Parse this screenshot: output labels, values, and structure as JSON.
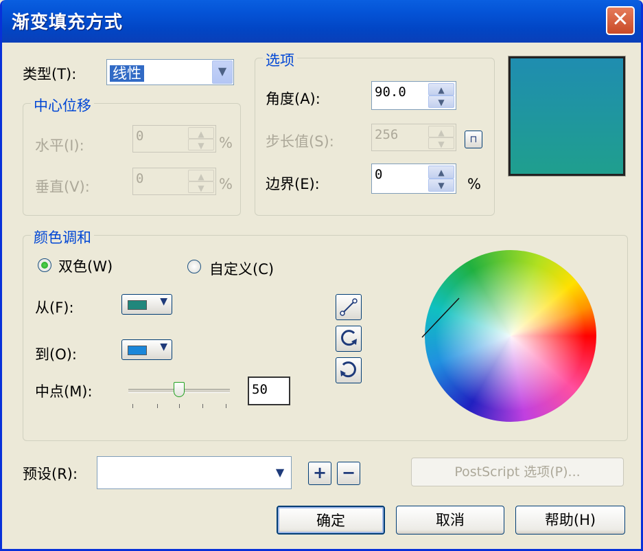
{
  "window": {
    "title": "渐变填充方式",
    "close": "✕"
  },
  "type": {
    "label": "类型(T):",
    "value": "线性"
  },
  "center_offset": {
    "legend": "中心位移",
    "horizontal_label": "水平(I):",
    "horizontal_value": "0",
    "horizontal_unit": "%",
    "vertical_label": "垂直(V):",
    "vertical_value": "0",
    "vertical_unit": "%"
  },
  "options": {
    "legend": "选项",
    "angle_label": "角度(A):",
    "angle_value": "90.0",
    "steps_label": "步长值(S):",
    "steps_value": "256",
    "edge_label": "边界(E):",
    "edge_value": "0",
    "edge_unit": "%"
  },
  "color_blend": {
    "legend": "颜色调和",
    "two_color_label": "双色(W)",
    "custom_label": "自定义(C)",
    "from_label": "从(F):",
    "to_label": "到(O):",
    "midpoint_label": "中点(M):",
    "midpoint_value": "50",
    "from_color": "#21877c",
    "to_color": "#1a86d9"
  },
  "preview": {
    "from_color": "#1f8db0",
    "to_color": "#1f9f8e"
  },
  "presets": {
    "label": "预设(R):",
    "value": ""
  },
  "buttons": {
    "postscript": "PostScript 选项(P)...",
    "ok": "确定",
    "cancel": "取消",
    "help": "帮助(H)"
  }
}
